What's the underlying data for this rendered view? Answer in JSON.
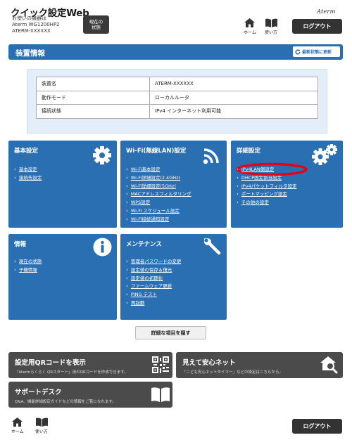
{
  "header": {
    "app_title": "クイック設定Web",
    "device_line1": "お使いの機器は",
    "device_line2": "Aterm WG1200HP2",
    "device_line3": "ATERM-XXXXXX",
    "current_state_button": "現在の\n状態",
    "brand": "Aterm",
    "home_label": "ホーム",
    "howto_label": "使い方",
    "logout_label": "ログアウト"
  },
  "device_info": {
    "title": "装置情報",
    "refresh_label": "最新状態に更新",
    "rows": [
      {
        "label": "装置名",
        "value": "ATERM-XXXXXX"
      },
      {
        "label": "動作モード",
        "value": "ローカルルータ"
      },
      {
        "label": "接続状態",
        "value": "IPv4 インターネット利用可能"
      }
    ]
  },
  "tiles": {
    "basic": {
      "title": "基本設定",
      "icon": "gear-icon",
      "links": [
        "基本設定",
        "接続先設定"
      ]
    },
    "wifi": {
      "title": "Wi-Fi(無線LAN)設定",
      "icon": "wifi-icon",
      "links": [
        "Wi-Fi基本設定",
        "Wi-Fi詳細設定(2.4GHz)",
        "Wi-Fi詳細設定(5GHz)",
        "MACアドレスフィルタリング",
        "WPS設定",
        "Wi-Fi スケジュール設定",
        "Wi-Fi接続通知設定"
      ]
    },
    "advanced": {
      "title": "詳細設定",
      "icon": "gears-icon",
      "links": [
        "IPv4LAN側設定",
        "DHCP固定割当設定",
        "IPv4パケットフィルタ設定",
        "ポートマッピング設定",
        "その他の設定"
      ],
      "highlight_color": "#e60012"
    },
    "info": {
      "title": "情報",
      "icon": "info-icon",
      "links": [
        "現在の状態",
        "子機情報"
      ]
    },
    "maintenance": {
      "title": "メンテナンス",
      "icon": "wrench-icon",
      "links": [
        "管理者パスワードの変更",
        "設定値の保存＆復元",
        "設定値の初期化",
        "ファームウェア更新",
        "PING テスト",
        "再起動"
      ]
    }
  },
  "hide_detail_button": "詳細な項目を隠す",
  "cards": {
    "qr": {
      "title": "設定用QRコードを表示",
      "desc": "「Atermらくらく QRスタート」用のQRコードを作成できます。",
      "icon": "qr-code-icon"
    },
    "safe": {
      "title": "見えて安心ネット",
      "desc": "「こども安心ネットタイマー」などの設定はこちらから。",
      "icon": "house-search-icon"
    },
    "support": {
      "title": "サポートデスク",
      "desc": "Q&A、機能詳細設定ガイドなどの情報をご覧になれます。",
      "icon": "book-icon"
    }
  },
  "footer": {
    "home_label": "ホーム",
    "howto_label": "使い方",
    "logout_label": "ログアウト"
  },
  "colors": {
    "tile_blue": "#2b6fb3",
    "card_gray": "#4b4b4b",
    "info_bg": "#e3eef9"
  }
}
